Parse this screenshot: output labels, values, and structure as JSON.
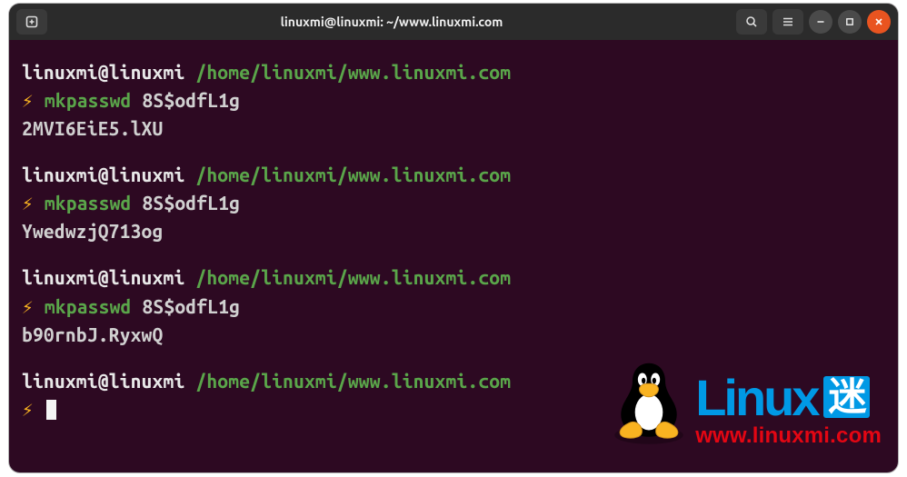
{
  "titlebar": {
    "title": "linuxmi@linuxmi: ~/www.linuxmi.com"
  },
  "prompt": {
    "user": "linuxmi@linuxmi",
    "path": "/home/linuxmi/www.linuxmi.com",
    "symbol": "⚡"
  },
  "blocks": [
    {
      "command": "mkpasswd",
      "arg": "8S$odfL1g",
      "output": "2MVI6EiE5.lXU"
    },
    {
      "command": "mkpasswd",
      "arg": "8S$odfL1g",
      "output": "YwedwzjQ713og"
    },
    {
      "command": "mkpasswd",
      "arg": "8S$odfL1g",
      "output": "b90rnbJ.RyxwQ"
    }
  ],
  "watermark": {
    "logo_main": "Linux",
    "logo_badge": "迷",
    "url": "www.linuxmi.com"
  }
}
